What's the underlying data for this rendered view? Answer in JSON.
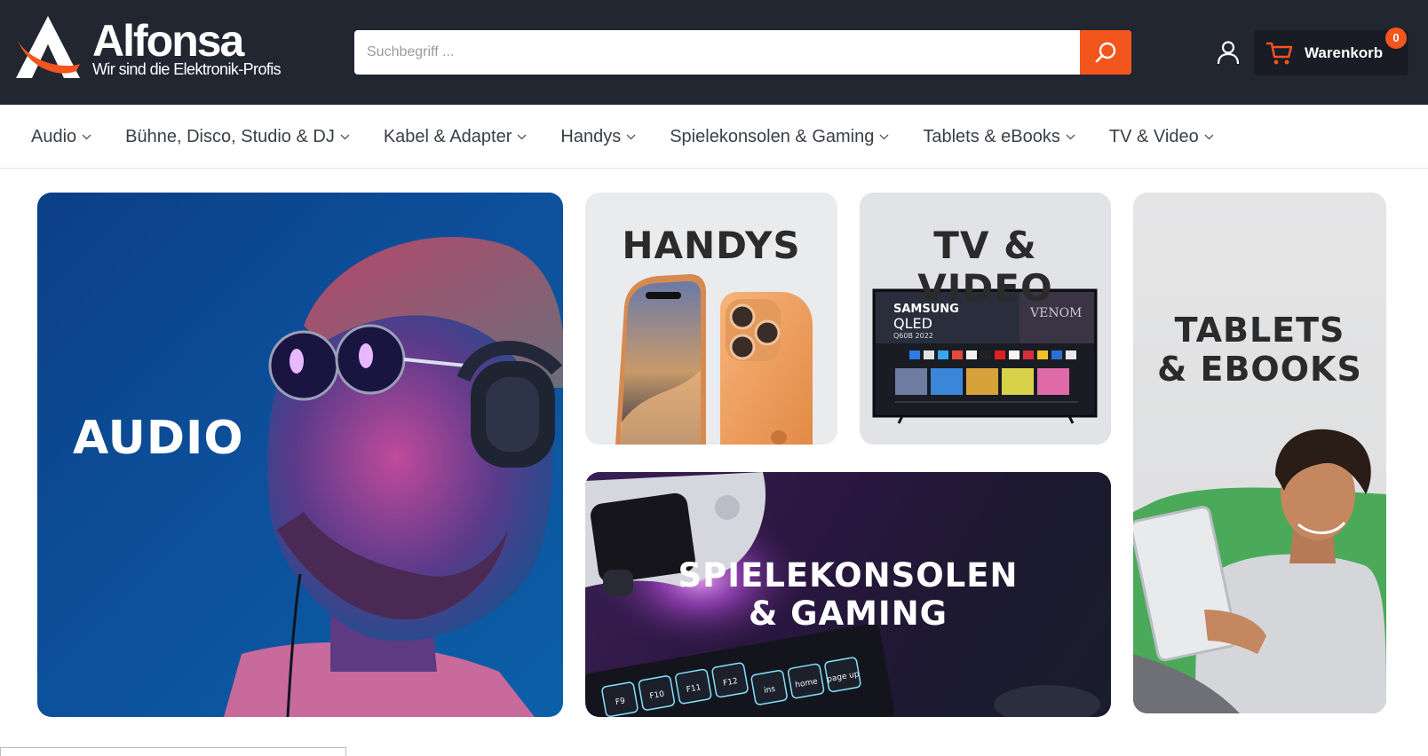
{
  "brand": {
    "name": "Alfonsa",
    "tagline": "Wir sind die Elektronik-Profis"
  },
  "search": {
    "placeholder": "Suchbegriff ...",
    "value": ""
  },
  "cart": {
    "label": "Warenkorb",
    "count": "0"
  },
  "colors": {
    "header_bg": "#222631",
    "accent": "#f2561d"
  },
  "icons": {
    "search": "search-icon",
    "account": "user-icon",
    "cart": "cart-icon",
    "chevron": "chevron-down-icon"
  },
  "nav": {
    "items": [
      {
        "label": "Audio"
      },
      {
        "label": "Bühne, Disco, Studio & DJ"
      },
      {
        "label": "Kabel & Adapter"
      },
      {
        "label": "Handys"
      },
      {
        "label": "Spielekonsolen & Gaming"
      },
      {
        "label": "Tablets & eBooks"
      },
      {
        "label": "TV & Video"
      }
    ]
  },
  "tiles": {
    "audio": {
      "title": "AUDIO"
    },
    "handys": {
      "title": "HANDYS"
    },
    "tv": {
      "title": "TV & VIDEO",
      "screen_brand": "SAMSUNG",
      "screen_model": "QLED",
      "screen_sub": "Q60B 2022",
      "screen_film": "VENOM"
    },
    "tablets": {
      "title_line1": "TABLETS",
      "title_line2": "& EBOOKS"
    },
    "gaming": {
      "title_line1": "SPIELEKONSOLEN",
      "title_line2": "& GAMING",
      "keys": [
        "F9",
        "F10",
        "F11",
        "F12",
        "ins",
        "home",
        "page up"
      ]
    }
  }
}
